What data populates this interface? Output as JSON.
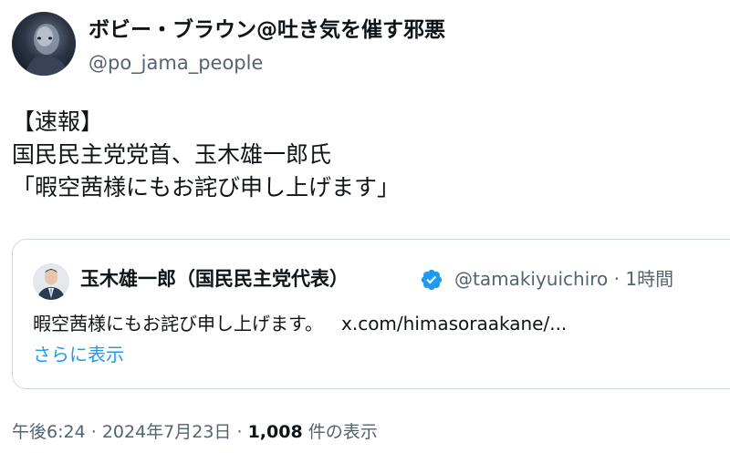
{
  "author": {
    "display_name": "ボビー・ブラウン@吐き気を催す邪悪",
    "handle": "@po_jama_people",
    "avatar_icon": "avatar-photo"
  },
  "tweet": {
    "lines": [
      "【速報】",
      "国民民主党党首、玉木雄一郎氏",
      "「暇空茜様にもお詫び申し上げます」"
    ]
  },
  "quoted_tweet": {
    "display_name": "玉木雄一郎（国民民主党代表）",
    "verified_icon": "verified-badge-icon",
    "handle": "@tamakiyuichiro",
    "separator": "·",
    "time": "1時間",
    "text": "暇空茜様にもお詫び申し上げます。",
    "link": "x.com/himasoraakane/...",
    "show_more": "さらに表示"
  },
  "footer": {
    "time": "午後6:24",
    "sep1": "·",
    "date": "2024年7月23日",
    "sep2": "·",
    "view_count": "1,008",
    "view_label": "件の表示"
  },
  "colors": {
    "text": "#0f1419",
    "secondary": "#536471",
    "link": "#1d9bf0",
    "border": "#cfd9de"
  }
}
